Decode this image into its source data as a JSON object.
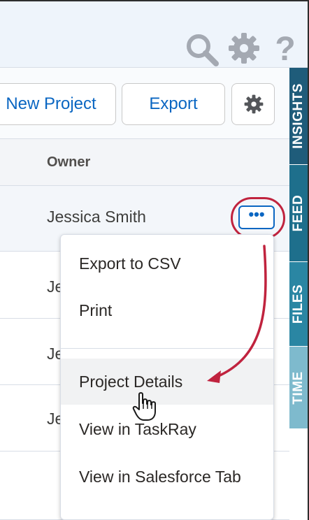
{
  "toolbar": {
    "new_project_label": "New Project",
    "export_label": "Export"
  },
  "table": {
    "owner_header": "Owner",
    "rows": [
      {
        "owner": "Jessica Smith"
      },
      {
        "owner": "Je"
      },
      {
        "owner": "Je"
      },
      {
        "owner": "Je"
      }
    ]
  },
  "row_actions": {
    "more_label": "•••"
  },
  "menu": {
    "items": [
      {
        "label": "Export to CSV"
      },
      {
        "label": "Print"
      },
      {
        "label": "Project Details"
      },
      {
        "label": "View in TaskRay"
      },
      {
        "label": "View in Salesforce Tab"
      }
    ]
  },
  "side_tabs": [
    {
      "label": "INSIGHTS"
    },
    {
      "label": "FEED"
    },
    {
      "label": "FILES"
    },
    {
      "label": "TIME"
    }
  ],
  "header_icons": {
    "help_glyph": "?"
  },
  "colors": {
    "accent": "#0a66c2",
    "annotation": "#c0233e",
    "tab_insights": "#1f5c7a",
    "tab_feed": "#1e6f8c",
    "tab_files": "#2a86a3",
    "tab_time": "#7ebacd"
  }
}
